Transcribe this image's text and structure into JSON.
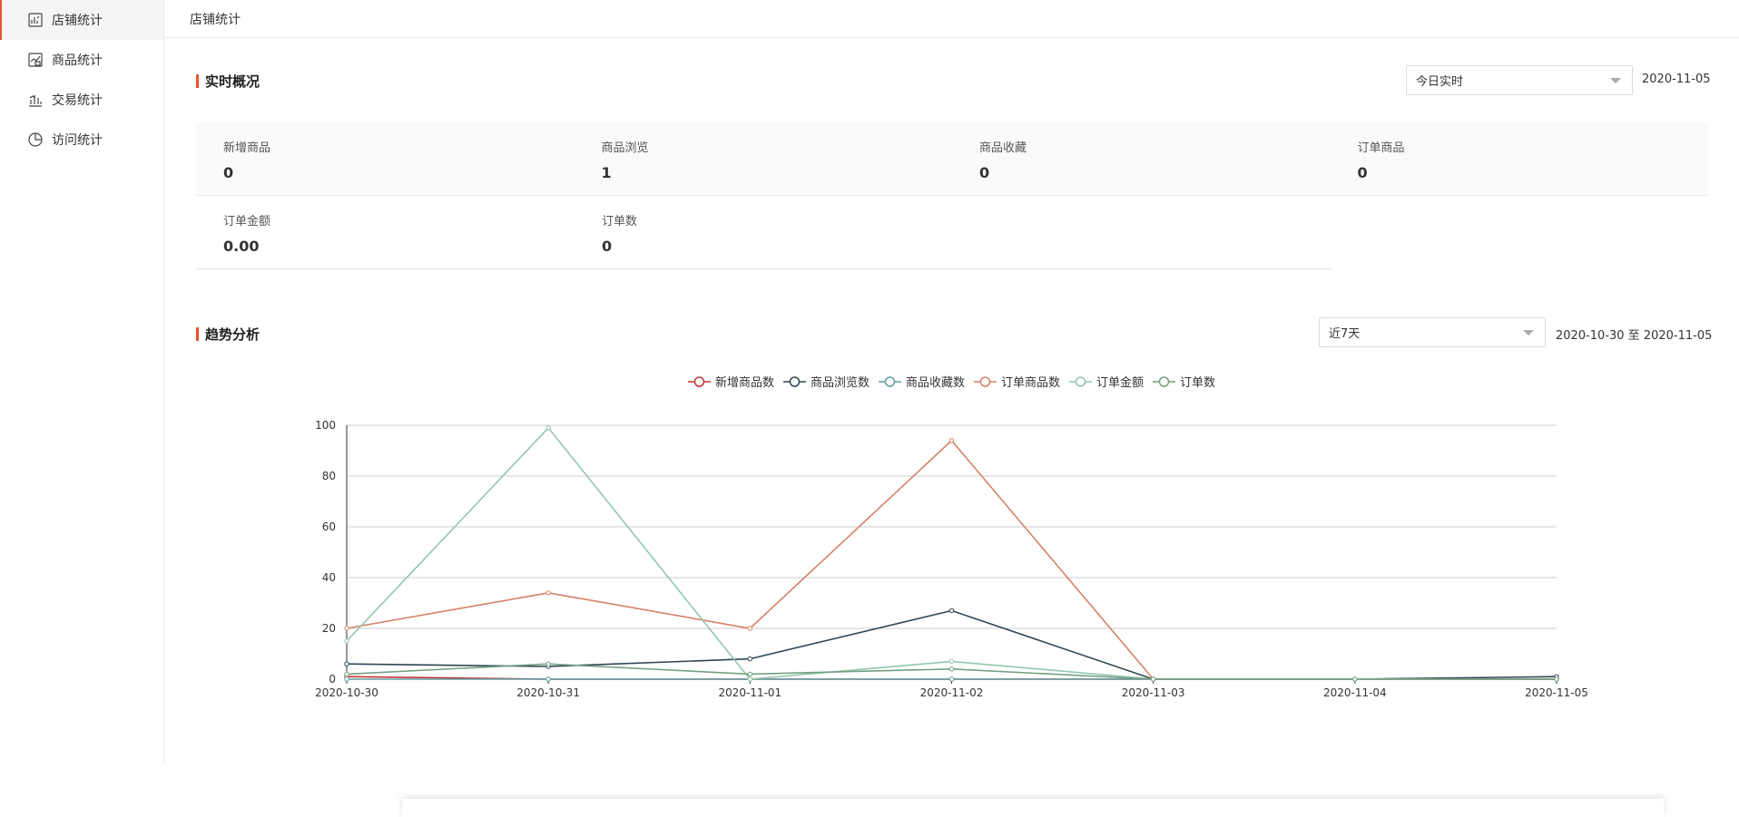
{
  "sidebar": {
    "items": [
      {
        "label": "店铺统计",
        "icon": "store-chart-icon"
      },
      {
        "label": "商品统计",
        "icon": "goods-chart-icon"
      },
      {
        "label": "交易统计",
        "icon": "trade-chart-icon"
      },
      {
        "label": "访问统计",
        "icon": "pie-chart-icon"
      }
    ]
  },
  "header": {
    "breadcrumb": "店铺统计"
  },
  "overview": {
    "title": "实时概况",
    "select_value": "今日实时",
    "date": "2020-11-05",
    "stats": [
      {
        "label": "新增商品",
        "value": "0"
      },
      {
        "label": "商品浏览",
        "value": "1"
      },
      {
        "label": "商品收藏",
        "value": "0"
      },
      {
        "label": "订单商品",
        "value": "0"
      },
      {
        "label": "订单金额",
        "value": "0.00"
      },
      {
        "label": "订单数",
        "value": "0"
      }
    ]
  },
  "trend": {
    "title": "趋势分析",
    "select_value": "近7天",
    "date_range": "2020-10-30 至 2020-11-05"
  },
  "colors": {
    "accent": "#e4572e"
  },
  "chart_data": {
    "type": "line",
    "categories": [
      "2020-10-30",
      "2020-10-31",
      "2020-11-01",
      "2020-11-02",
      "2020-11-03",
      "2020-11-04",
      "2020-11-05"
    ],
    "ylim": [
      0,
      100
    ],
    "yticks": [
      0,
      20,
      40,
      60,
      80,
      100
    ],
    "grid": true,
    "legend_position": "top-center",
    "series": [
      {
        "name": "新增商品数",
        "color": "#c23531",
        "values": [
          1,
          0,
          0,
          0,
          0,
          0,
          0
        ]
      },
      {
        "name": "商品浏览数",
        "color": "#2f4554",
        "values": [
          6,
          5,
          8,
          27,
          0,
          0,
          1
        ]
      },
      {
        "name": "商品收藏数",
        "color": "#61a0a8",
        "values": [
          0,
          0,
          0,
          0,
          0,
          0,
          0
        ]
      },
      {
        "name": "订单商品数",
        "color": "#d48265",
        "values": [
          20,
          34,
          20,
          94,
          0,
          0,
          0
        ]
      },
      {
        "name": "订单金额",
        "color": "#91c7ae",
        "values": [
          15,
          99,
          0,
          7,
          0,
          0,
          0
        ]
      },
      {
        "name": "订单数",
        "color": "#749f83",
        "values": [
          2,
          6,
          2,
          4,
          0,
          0,
          0
        ]
      }
    ]
  }
}
